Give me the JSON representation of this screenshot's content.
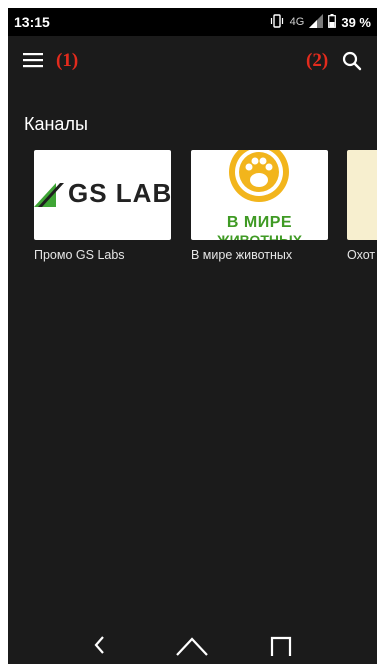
{
  "status_bar": {
    "time": "13:15",
    "network": "4G",
    "battery": "39 %"
  },
  "app_bar": {
    "menu_icon": "hamburger-icon",
    "menu_marker": "(1)",
    "search_marker": "(2)",
    "search_icon": "search-icon"
  },
  "section": {
    "title": "Каналы"
  },
  "channels": [
    {
      "label": "Промо GS Labs",
      "thumb_text": "GS LABS"
    },
    {
      "label": "В мире животных",
      "thumb_text": "В МИРЕ",
      "thumb_text2": "ЖИВОТНЫХ"
    },
    {
      "label": "Охот"
    }
  ],
  "nav_bar": {
    "back_icon": "back-icon",
    "home_icon": "home-icon",
    "recents_icon": "recents-icon"
  },
  "colors": {
    "background": "#1b1b1b",
    "marker": "#e32b1d",
    "paw_yellow": "#f2b51c",
    "paw_green": "#3f9a24",
    "logo_green": "#3fa535"
  }
}
